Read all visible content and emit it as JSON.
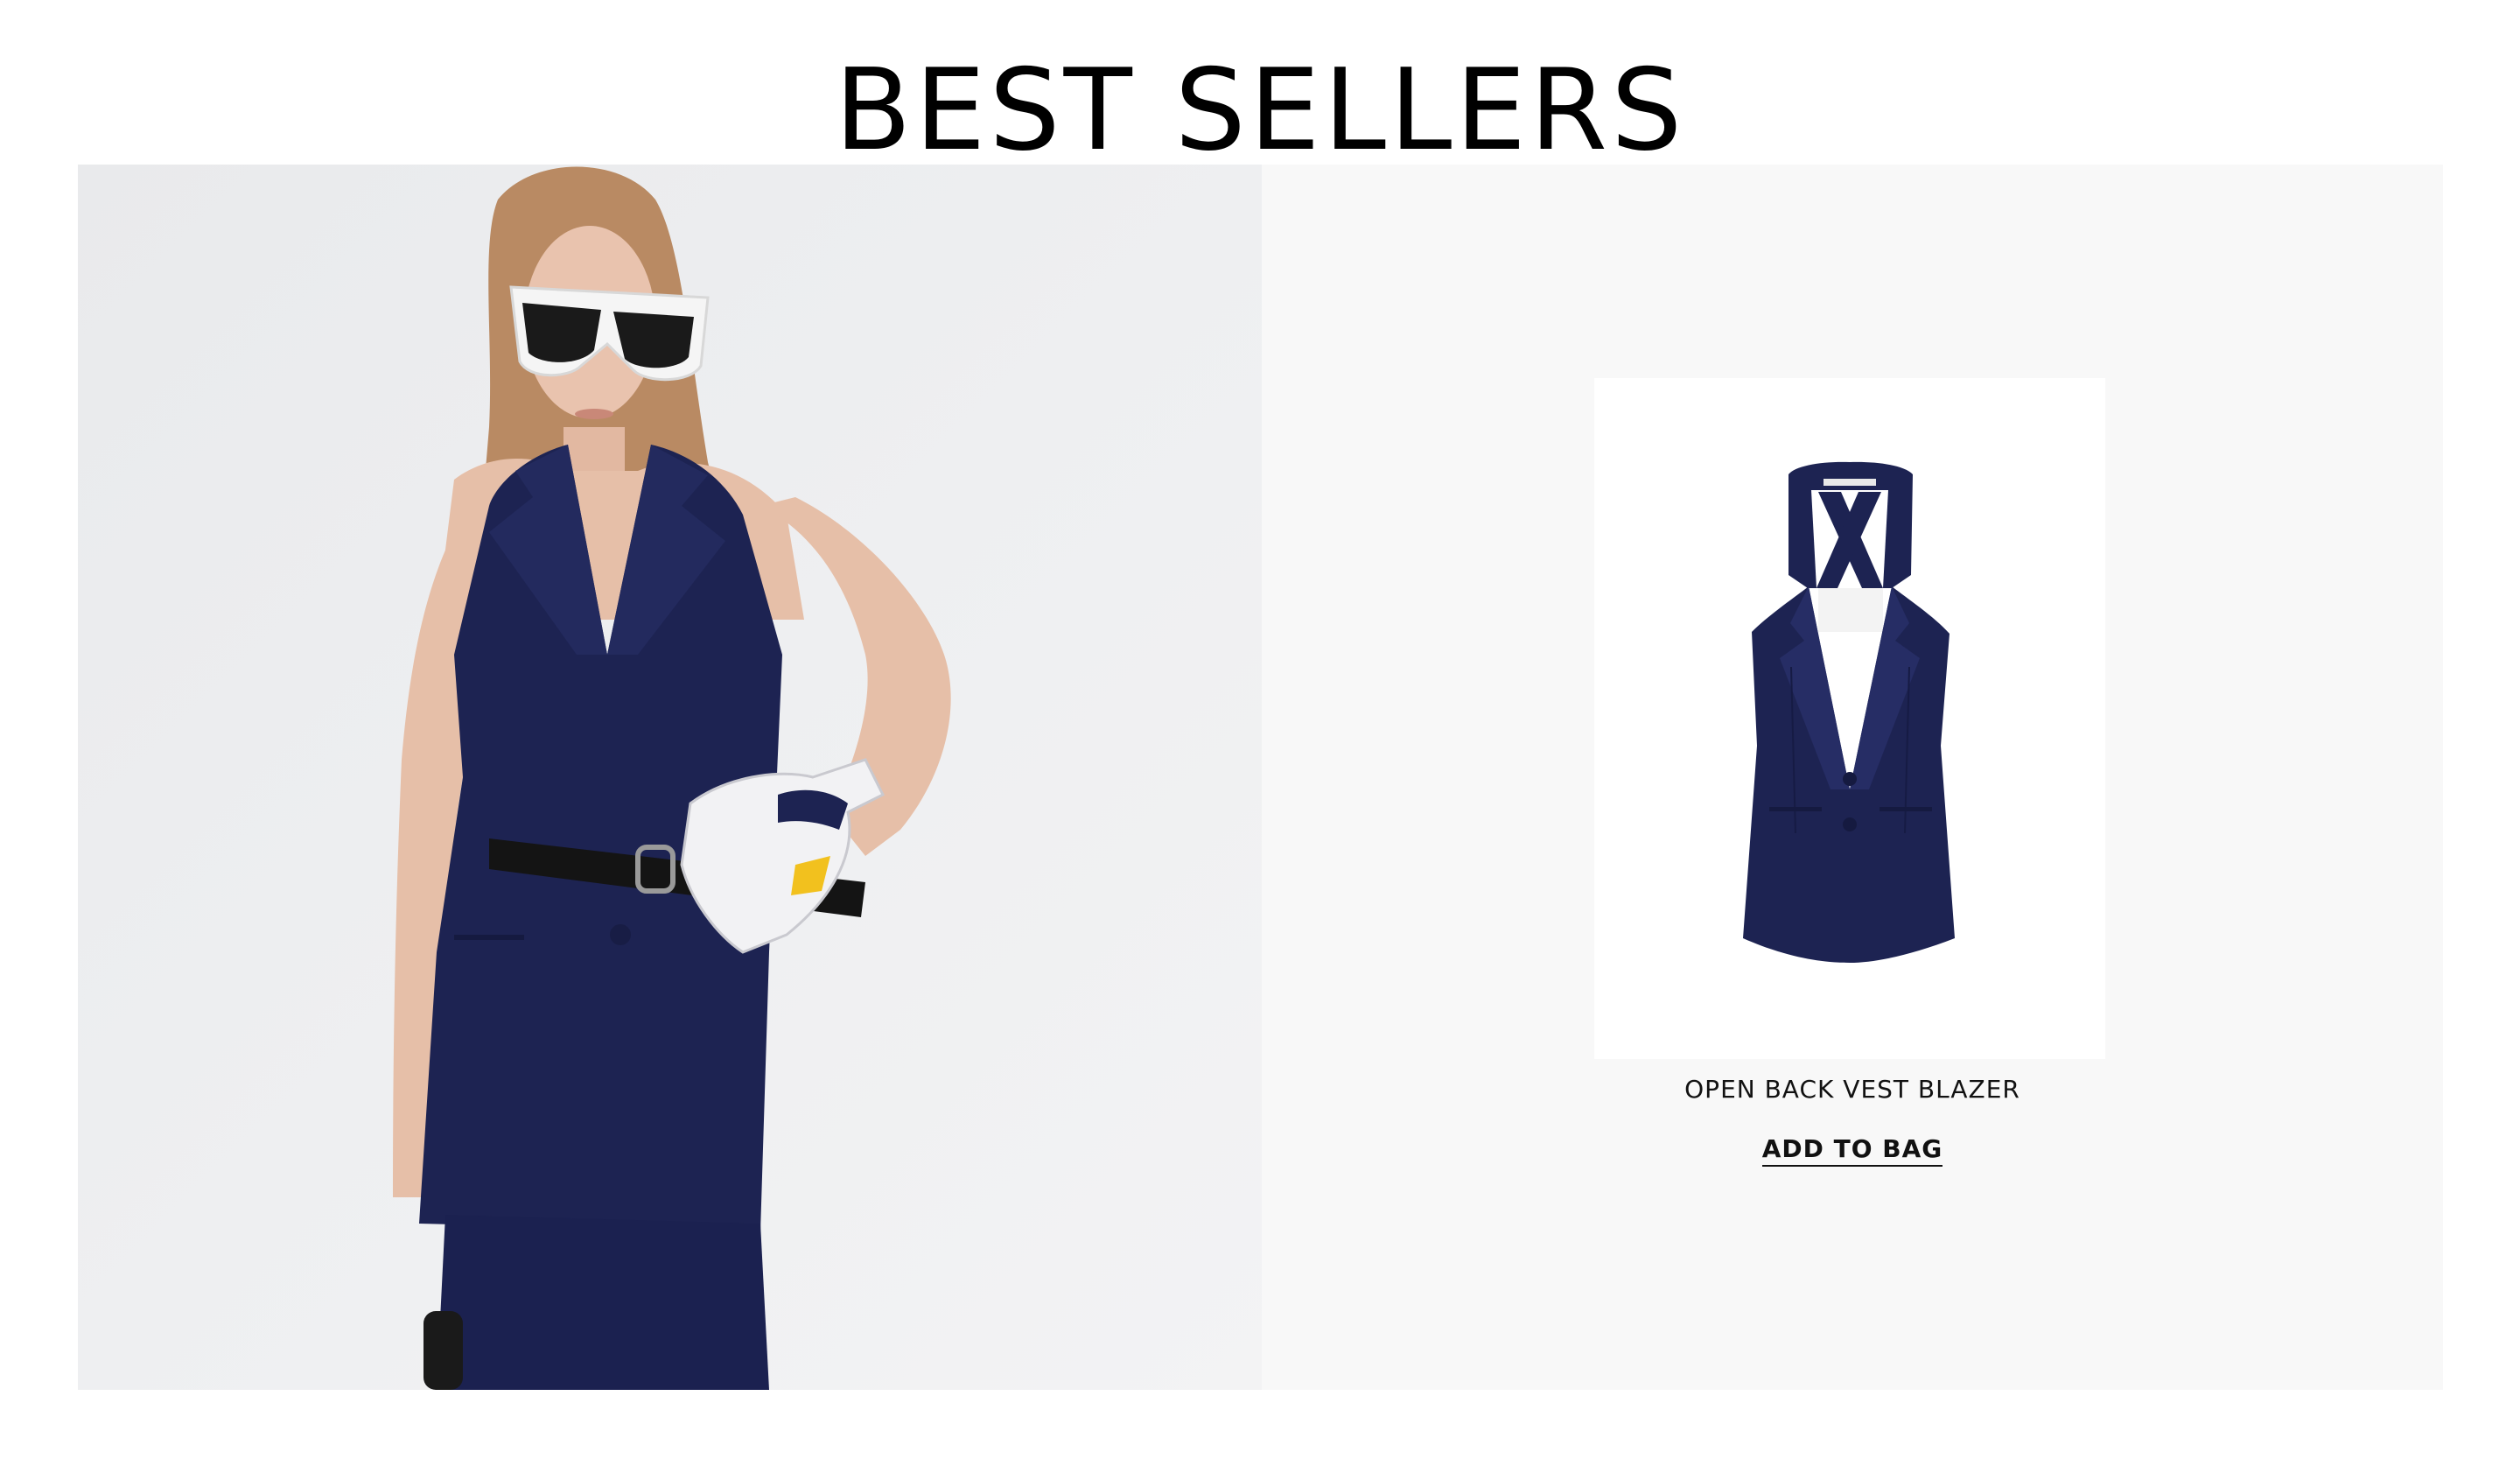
{
  "section": {
    "title": "BEST SELLERS"
  },
  "lifestyle": {
    "image_icon": "model-photo"
  },
  "product": {
    "name": "OPEN BACK VEST BLAZER",
    "add_to_bag_label": "ADD TO BAG",
    "image_icon": "vest-blazer-photo"
  },
  "colors": {
    "navy": "#1d2352",
    "panel_bg": "#f8f8f8",
    "lifestyle_bg": "#eeeff1"
  }
}
